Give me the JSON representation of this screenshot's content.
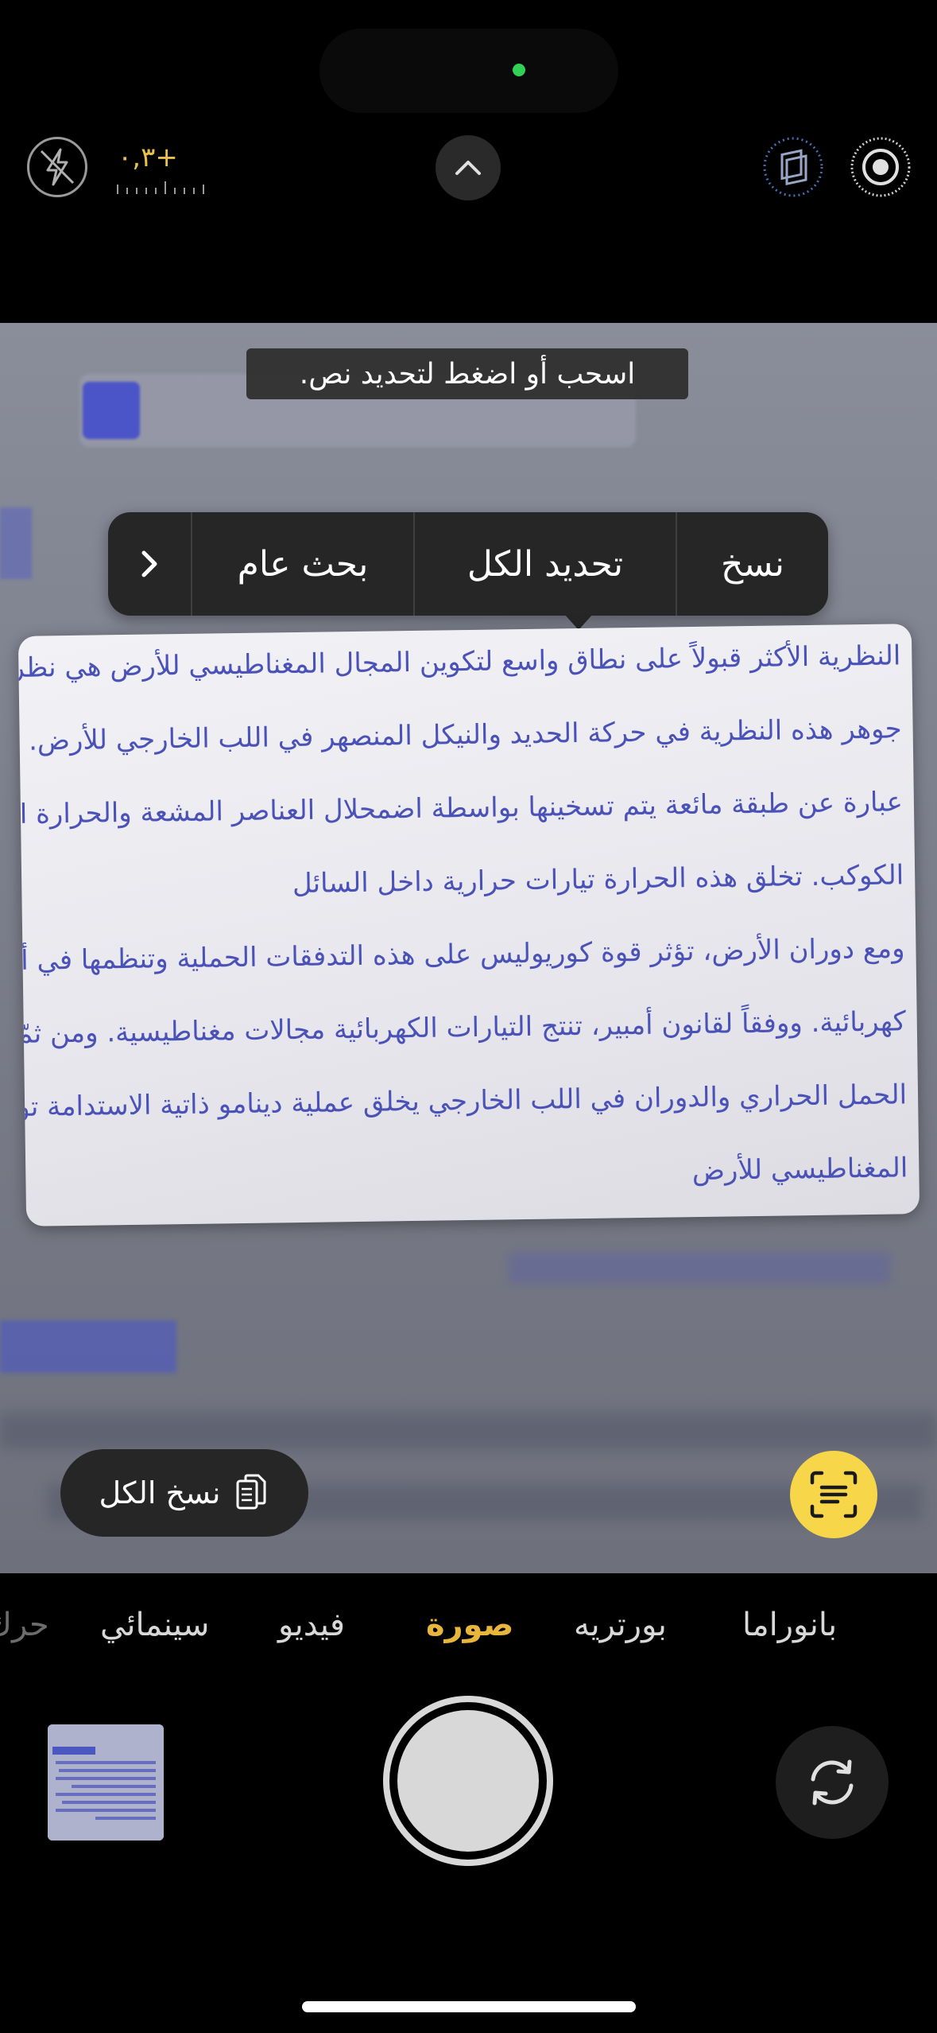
{
  "status": {
    "exposure_value": "+٠,٣"
  },
  "viewfinder": {
    "hint": "اسحب أو اضغط لتحديد نص."
  },
  "context_menu": {
    "copy": "نسخ",
    "select_all": "تحديد الكل",
    "look_up": "بحث عام",
    "next": "›"
  },
  "recognized_text": {
    "lines": [
      "النظرية الأكثر قبولاً على نطاق واسع لتكوين المجال المغناطيسي للأرض هي نظر",
      "جوهر هذه النظرية في حركة الحديد والنيكل المنصهر في اللب الخارجي للأرض.",
      "عبارة عن طبقة مائعة يتم تسخينها بواسطة اضمحلال العناصر المشعة والحرارة ال",
      "الكوكب. تخلق هذه الحرارة تيارات حرارية داخل السائل",
      "ومع دوران الأرض، تؤثر قوة كوريوليس على هذه التدفقات الحملية وتنظمها في أنم",
      "كهربائية. ووفقاً لقانون أمبير، تنتج التيارات الكهربائية مجالات مغناطيسية. ومن ثمّ",
      "الحمل الحراري والدوران في اللب الخارجي يخلق عملية دينامو ذاتية الاستدامة تولد",
      "المغناطيسي للأرض"
    ]
  },
  "actions": {
    "copy_all": "نسخ الكل"
  },
  "modes": {
    "panorama": "بانوراما",
    "portrait": "بورتريه",
    "photo": "صورة",
    "video": "فيديو",
    "cinematic": "سينمائي",
    "cut": "حرك"
  },
  "icons": {
    "flash": "flash-off-icon",
    "chevron": "chevron-up-icon",
    "live_photo": "live-photo-icon",
    "settings": "camera-settings-icon",
    "copy": "copy-icon",
    "live_text": "live-text-icon",
    "flip": "flip-camera-icon"
  },
  "colors": {
    "accent_yellow": "#e8b63a",
    "live_text_button": "#f7d64a",
    "ocr_text": "#4a52b8",
    "camera_active_dot": "#31d158"
  }
}
